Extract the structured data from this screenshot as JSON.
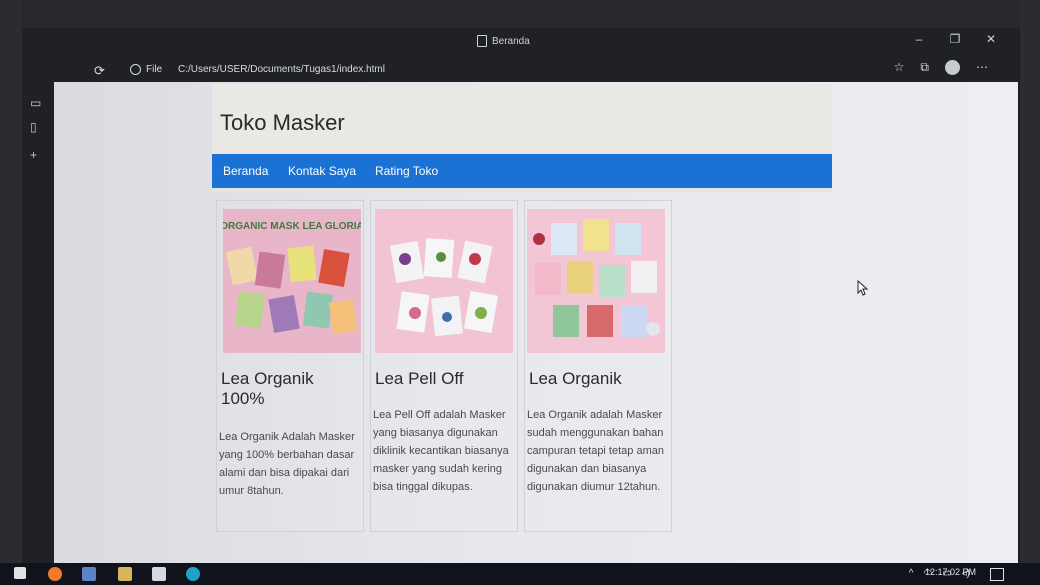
{
  "browser": {
    "tab_title": "Beranda",
    "site_info_label": "File",
    "url": "C:/Users/USER/Documents/Tugas1/index.html",
    "icons": {
      "refresh": "refresh-icon",
      "favorites": "favorites-icon",
      "collections": "collections-icon",
      "profile": "profile-icon",
      "menu": "more-icon"
    }
  },
  "page": {
    "title": "Toko Masker",
    "nav": [
      "Beranda",
      "Kontak Saya",
      "Rating Toko"
    ],
    "products": [
      {
        "title": "Lea Organik 100%",
        "image_caption": "ORGANIC MASK LEA GLORIA",
        "description": "Lea Organik Adalah Masker yang 100% berbahan dasar alami dan bisa dipakai dari umur 8tahun."
      },
      {
        "title": "Lea Pell Off",
        "image_caption": "",
        "description": "Lea Pell Off adalah Masker yang biasanya digunakan diklinik kecantikan biasanya masker yang sudah kering bisa tinggal dikupas."
      },
      {
        "title": "Lea Organik",
        "image_caption": "",
        "description": "Lea Organik adalah Masker sudah menggunakan bahan campuran tetapi tetap aman digunakan dan biasanya digunakan diumur 12tahun."
      }
    ]
  },
  "taskbar": {
    "clock": "12:17:02 PM"
  },
  "colors": {
    "nav_bg": "#1a73d4",
    "header_bg": "#e9e8e4",
    "taskbar_bg": "#10131a"
  }
}
